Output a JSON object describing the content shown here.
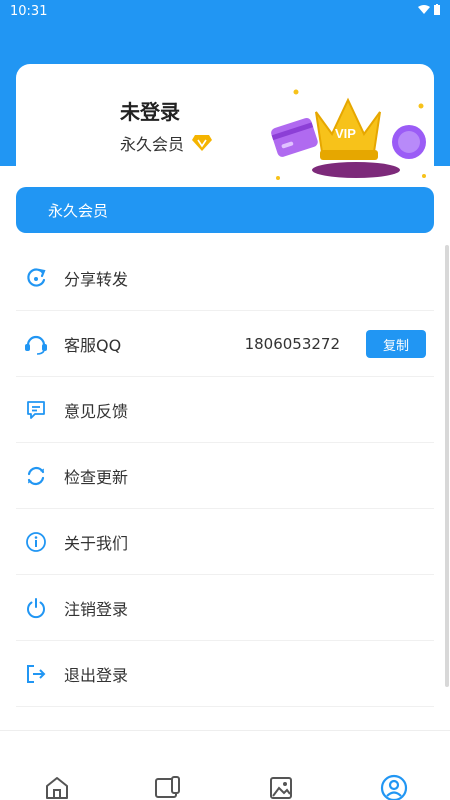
{
  "status_bar": {
    "time": "10:31"
  },
  "profile": {
    "name": "未登录",
    "member_status": "永久会员"
  },
  "member_bar": {
    "label": "永久会员"
  },
  "menu": [
    {
      "label": "分享转发",
      "icon": "share-icon"
    },
    {
      "label": "客服QQ",
      "icon": "headset-icon",
      "value": "1806053272",
      "button": "复制"
    },
    {
      "label": "意见反馈",
      "icon": "feedback-icon"
    },
    {
      "label": "检查更新",
      "icon": "refresh-icon"
    },
    {
      "label": "关于我们",
      "icon": "info-icon"
    },
    {
      "label": "注销登录",
      "icon": "power-icon"
    },
    {
      "label": "退出登录",
      "icon": "logout-icon"
    }
  ],
  "bottom_nav": [
    {
      "name": "home-icon",
      "active": false
    },
    {
      "name": "video-icon",
      "active": false
    },
    {
      "name": "image-icon",
      "active": false
    },
    {
      "name": "profile-icon",
      "active": true
    }
  ],
  "colors": {
    "primary": "#2196f3",
    "gold": "#f5b400",
    "purple": "#9b5cf6"
  }
}
